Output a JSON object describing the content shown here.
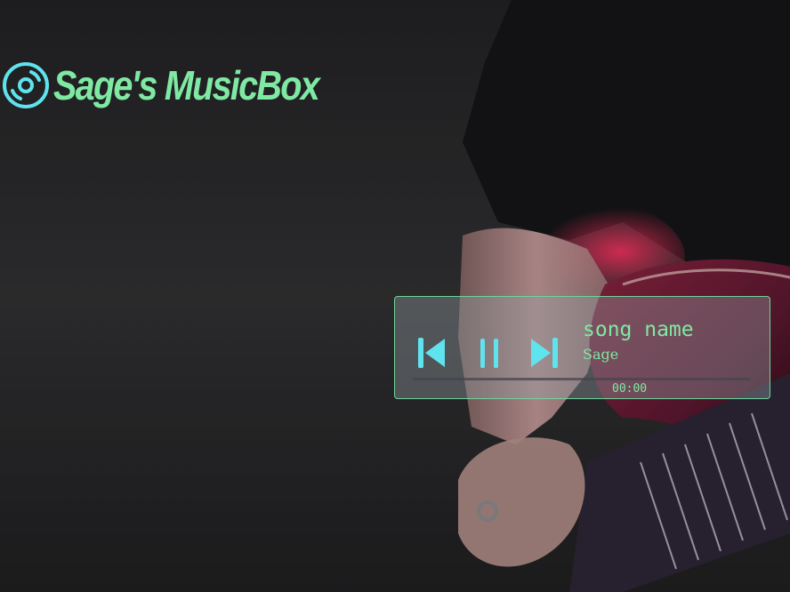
{
  "app": {
    "title": "Sage's MusicBox",
    "logo_icon": "vinyl-disc-icon"
  },
  "player": {
    "song_name": "song name",
    "artist": "Sage",
    "time": "00:00",
    "progress": 0,
    "controls": {
      "previous_icon": "skip-previous-icon",
      "pause_icon": "pause-icon",
      "next_icon": "skip-next-icon"
    }
  },
  "colors": {
    "accent_green": "#7fe9a3",
    "icon_cyan": "#5fe3ec",
    "background": "#1c1c1e",
    "player_border": "#6fd49a"
  }
}
